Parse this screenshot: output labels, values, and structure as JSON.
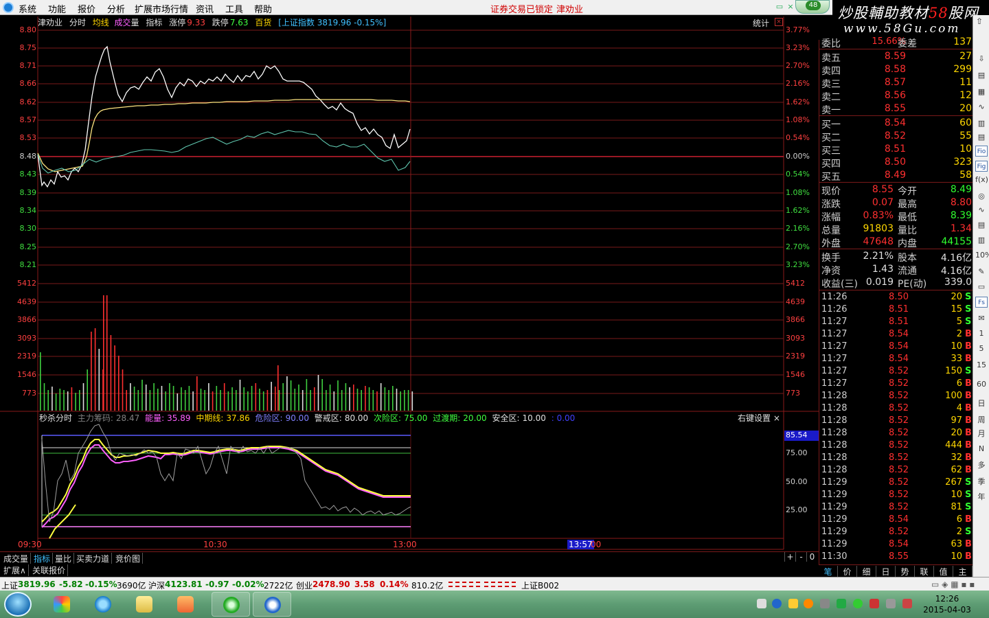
{
  "menu": {
    "items": [
      "系统",
      "功能",
      "报价",
      "分析",
      "扩展市场行情",
      "资讯",
      "工具",
      "帮助"
    ],
    "warn1": "证券交易已锁定",
    "warn2": "津劝业",
    "badge": "48"
  },
  "watermark": {
    "line1_a": "炒股輔助教材",
    "line1_b": "58",
    "line1_c": "股网",
    "line2": "www.58Gu.com"
  },
  "chart_header": {
    "name": "津劝业",
    "tab1": "分时",
    "tab2": "均线",
    "tab3": "成交",
    "tab3b": "量",
    "tab4": "指标",
    "zt_label": "涨停",
    "zt_value": "9.33",
    "dt_label": "跌停",
    "dt_value": "7.63",
    "bh": "百货",
    "index": "[上证指数 3819.96 -0.15%]"
  },
  "stat_label": "统计",
  "price_axis_left": [
    "8.80",
    "8.75",
    "8.71",
    "8.66",
    "8.62",
    "8.57",
    "8.53",
    "8.48",
    "8.43",
    "8.39",
    "8.34",
    "8.30",
    "8.25",
    "8.21"
  ],
  "pct_axis_right": [
    "3.77%",
    "3.23%",
    "2.70%",
    "2.16%",
    "1.62%",
    "1.08%",
    "0.54%",
    "0.00%",
    "0.54%",
    "1.08%",
    "1.62%",
    "2.16%",
    "2.70%",
    "3.23%"
  ],
  "vol_axis": [
    "5412",
    "4639",
    "3866",
    "3093",
    "2319",
    "1546",
    "773"
  ],
  "indicator_header": {
    "name": "秒杀分时",
    "f1": "主力筹码:",
    "v1": "28.47",
    "f2": "能量:",
    "v2": "35.89",
    "f3": "中期线:",
    "v3": "37.86",
    "f4": "危险区:",
    "v4": "90.00",
    "f5": "警戒区:",
    "v5": "80.00",
    "f6": "次险区:",
    "v6": "75.00",
    "f7": "过渡期:",
    "v7": "20.00",
    "f8": "安全区:",
    "v8": "10.00",
    "v9": ": 0.00"
  },
  "indicator_settings": "右键设置 ×",
  "ind_axis": [
    "75.00",
    "50.00",
    "25.00"
  ],
  "ind_current": "85.54",
  "time_labels": [
    "09:30",
    "10:30",
    "13:00"
  ],
  "cursor_time": "13:57",
  "cursor_rest": "00",
  "bottom_tabs1": [
    "成交量",
    "指标",
    "量比",
    "买卖力道",
    "竞价图"
  ],
  "bottom_tabs2": [
    "扩展∧",
    "关联报价"
  ],
  "zoom": [
    "+",
    "-",
    "0"
  ],
  "orderbook_top": {
    "label": "委比",
    "value": "15.66%",
    "label2": "委差",
    "value2": "137"
  },
  "sells": [
    {
      "label": "卖五",
      "price": "8.59",
      "vol": "27"
    },
    {
      "label": "卖四",
      "price": "8.58",
      "vol": "299"
    },
    {
      "label": "卖三",
      "price": "8.57",
      "vol": "11"
    },
    {
      "label": "卖二",
      "price": "8.56",
      "vol": "12"
    },
    {
      "label": "卖一",
      "price": "8.55",
      "vol": "20"
    }
  ],
  "buys": [
    {
      "label": "买一",
      "price": "8.54",
      "vol": "60"
    },
    {
      "label": "买二",
      "price": "8.52",
      "vol": "55"
    },
    {
      "label": "买三",
      "price": "8.51",
      "vol": "10"
    },
    {
      "label": "买四",
      "price": "8.50",
      "vol": "323"
    },
    {
      "label": "买五",
      "price": "8.49",
      "vol": "58"
    }
  ],
  "quote": [
    {
      "l1": "现价",
      "v1": "8.55",
      "c1": "red",
      "l2": "今开",
      "v2": "8.49",
      "c2": "green"
    },
    {
      "l1": "涨跌",
      "v1": "0.07",
      "c1": "red",
      "l2": "最高",
      "v2": "8.80",
      "c2": "red"
    },
    {
      "l1": "涨幅",
      "v1": "0.83%",
      "c1": "red",
      "l2": "最低",
      "v2": "8.39",
      "c2": "green"
    },
    {
      "l1": "总量",
      "v1": "91803",
      "c1": "yellow",
      "l2": "量比",
      "v2": "1.34",
      "c2": "red"
    },
    {
      "l1": "外盘",
      "v1": "47648",
      "c1": "red",
      "l2": "内盘",
      "v2": "44155",
      "c2": "green"
    }
  ],
  "quote2": [
    {
      "l1": "换手",
      "v1": "2.21%",
      "l2": "股本",
      "v2": "4.16亿"
    },
    {
      "l1": "净资",
      "v1": "1.43",
      "l2": "流通",
      "v2": "4.16亿"
    },
    {
      "l1": "收益(三)",
      "v1": "0.019",
      "l2": "PE(动)",
      "v2": "339.0"
    }
  ],
  "ticks": [
    {
      "t": "11:26",
      "p": "8.50",
      "v": "20",
      "d": "S"
    },
    {
      "t": "11:26",
      "p": "8.51",
      "v": "15",
      "d": "S"
    },
    {
      "t": "11:27",
      "p": "8.51",
      "v": "5",
      "d": "S"
    },
    {
      "t": "11:27",
      "p": "8.54",
      "v": "2",
      "d": "B"
    },
    {
      "t": "11:27",
      "p": "8.54",
      "v": "10",
      "d": "B"
    },
    {
      "t": "11:27",
      "p": "8.54",
      "v": "33",
      "d": "B"
    },
    {
      "t": "11:27",
      "p": "8.52",
      "v": "150",
      "d": "S"
    },
    {
      "t": "11:27",
      "p": "8.52",
      "v": "6",
      "d": "B"
    },
    {
      "t": "11:28",
      "p": "8.52",
      "v": "100",
      "d": "B"
    },
    {
      "t": "11:28",
      "p": "8.52",
      "v": "4",
      "d": "B"
    },
    {
      "t": "11:28",
      "p": "8.52",
      "v": "97",
      "d": "B"
    },
    {
      "t": "11:28",
      "p": "8.52",
      "v": "20",
      "d": "B"
    },
    {
      "t": "11:28",
      "p": "8.52",
      "v": "444",
      "d": "B"
    },
    {
      "t": "11:28",
      "p": "8.52",
      "v": "32",
      "d": "B"
    },
    {
      "t": "11:28",
      "p": "8.52",
      "v": "62",
      "d": "B"
    },
    {
      "t": "11:29",
      "p": "8.52",
      "v": "267",
      "d": "S"
    },
    {
      "t": "11:29",
      "p": "8.52",
      "v": "10",
      "d": "S"
    },
    {
      "t": "11:29",
      "p": "8.52",
      "v": "81",
      "d": "S"
    },
    {
      "t": "11:29",
      "p": "8.54",
      "v": "6",
      "d": "B"
    },
    {
      "t": "11:29",
      "p": "8.52",
      "v": "2",
      "d": "S"
    },
    {
      "t": "11:29",
      "p": "8.54",
      "v": "63",
      "d": "B"
    },
    {
      "t": "11:30",
      "p": "8.55",
      "v": "10",
      "d": "B"
    }
  ],
  "right_tabs": [
    "笔",
    "价",
    "细",
    "日",
    "势",
    "联",
    "值",
    "主"
  ],
  "toolbar_icons": [
    "Fio",
    "Fig",
    "10%",
    "Fs",
    "1",
    "5",
    "15",
    "60",
    "日",
    "周",
    "月",
    "N",
    "多",
    "季",
    "年"
  ],
  "statusbar": {
    "sh_label": "上证",
    "sh_value": "3819.96",
    "sh_chg": "-5.82",
    "sh_pct": "-0.15%",
    "sh_amt": "3690亿",
    "hs_label": "沪深",
    "hs_value": "4123.81",
    "hs_chg": "-0.97",
    "hs_pct": "-0.02%",
    "hs_amt": "2722亿",
    "cy_label": "创业",
    "cy_value": "2478.90",
    "cy_chg": "3.58",
    "cy_pct": "0.14%",
    "cy_amt": "810.2亿",
    "code": "上证B002"
  },
  "clock": {
    "time": "12:26",
    "date": "2015-04-03"
  }
}
